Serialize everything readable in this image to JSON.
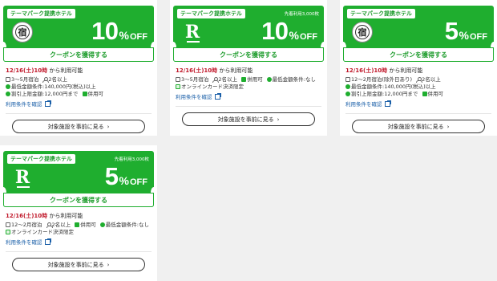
{
  "colors": {
    "brand_green": "#1fae2f",
    "date_red": "#c0182a",
    "link_blue": "#1a5fa8"
  },
  "common": {
    "tag_label": "テーマパーク提携ホテル",
    "first_come_label": "先着利用3,000枚",
    "get_coupon_label": "クーポンを獲得する",
    "avail_date": "12/16(土)10時",
    "avail_suffix": " から利用可能",
    "terms_label": "利用条件を確認",
    "view_facilities_label": "対象施設を事前に見る",
    "chevron": "›",
    "percent_sign": "%",
    "off_label": "OFF"
  },
  "coupons": [
    {
      "logo": "hotel-seal",
      "logo_char": "宿",
      "discount": "10",
      "conditions": [
        {
          "icon": "calendar-icon",
          "text": "3～5月宿泊"
        },
        {
          "icon": "person-icon",
          "text": "2名以上"
        },
        {
          "icon": "minimum-amount-icon",
          "text": "最低金額条件:140,000円(税込)以上"
        },
        {
          "icon": "discount-cap-icon",
          "text": "割引上限金額:12,000円まで"
        },
        {
          "icon": "combinable-icon",
          "text": "併用可"
        }
      ]
    },
    {
      "logo": "r-logo",
      "logo_char": "R",
      "discount": "10",
      "conditions": [
        {
          "icon": "calendar-icon",
          "text": "3～5月宿泊"
        },
        {
          "icon": "person-icon",
          "text": "2名以上"
        },
        {
          "icon": "combinable-icon",
          "text": "併用可"
        },
        {
          "icon": "minimum-amount-icon",
          "text": "最低金額条件:なし"
        },
        {
          "icon": "card-icon",
          "text": "オンラインカード決済限定"
        }
      ]
    },
    {
      "logo": "hotel-seal",
      "logo_char": "宿",
      "discount": "5",
      "conditions": [
        {
          "icon": "calendar-icon",
          "text": "12～2月宿泊(除外日あり)"
        },
        {
          "icon": "person-icon",
          "text": "2名以上"
        },
        {
          "icon": "minimum-amount-icon",
          "text": "最低金額条件:140,000円(税込)以上"
        },
        {
          "icon": "discount-cap-icon",
          "text": "割引上限金額:12,000円まで"
        },
        {
          "icon": "combinable-icon",
          "text": "併用可"
        }
      ]
    },
    {
      "logo": "r-logo",
      "logo_char": "R",
      "discount": "5",
      "conditions": [
        {
          "icon": "calendar-icon",
          "text": "12～2月宿泊"
        },
        {
          "icon": "person-icon",
          "text": "2名以上"
        },
        {
          "icon": "combinable-icon",
          "text": "併用可"
        },
        {
          "icon": "minimum-amount-icon",
          "text": "最低金額条件:なし"
        },
        {
          "icon": "card-icon",
          "text": "オンラインカード決済限定"
        }
      ]
    }
  ]
}
